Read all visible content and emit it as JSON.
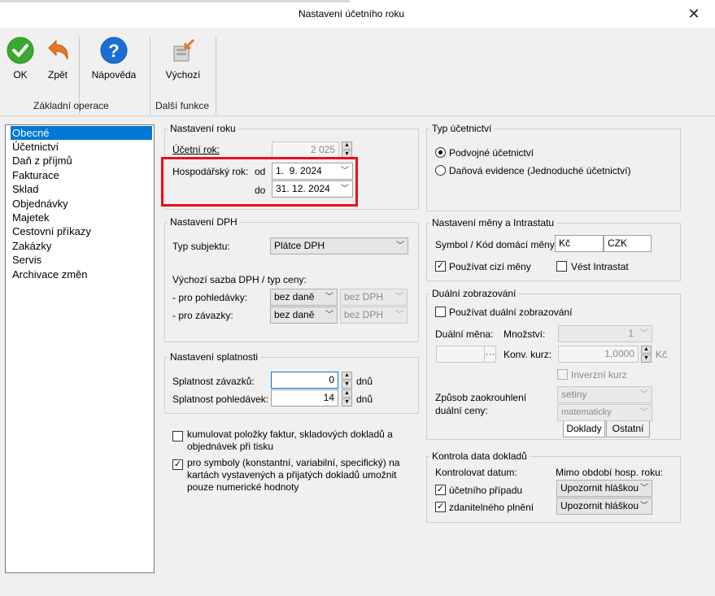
{
  "window": {
    "title": "Nastavení účetního roku",
    "close_glyph": "✕"
  },
  "toolbar": {
    "ok_label": "OK",
    "back_label": "Zpět",
    "help_label": "Nápověda",
    "default_label": "Výchozí",
    "group_basic": "Základní operace",
    "group_more": "Další funkce",
    "icons": {
      "ok": "check-icon",
      "back": "undo-arrow-icon",
      "help": "help-question-icon",
      "default": "reset-defaults-icon"
    }
  },
  "sidebar": {
    "items": [
      {
        "label": "Obecné",
        "selected": true
      },
      {
        "label": "Účetnictví"
      },
      {
        "label": "Daň z příjmů"
      },
      {
        "label": "Fakturace"
      },
      {
        "label": "Sklad"
      },
      {
        "label": "Objednávky"
      },
      {
        "label": "Majetek"
      },
      {
        "label": "Cestovní příkazy"
      },
      {
        "label": "Zakázky"
      },
      {
        "label": "Servis"
      },
      {
        "label": "Archivace změn"
      }
    ]
  },
  "year": {
    "group_label": "Nastavení roku",
    "accounting_year_label": "Účetní rok:",
    "accounting_year_value": "2 025",
    "fiscal_year_label": "Hospodářský rok:",
    "from_label": "od",
    "from_value": "1.  9. 2024",
    "to_label": "do",
    "to_value": "31. 12. 2024"
  },
  "vat": {
    "group_label": "Nastavení DPH",
    "subject_label": "Typ subjektu:",
    "subject_value": "Plátce DPH",
    "default_rate_label": "Výchozí sazba DPH / typ ceny:",
    "receivables_label": "- pro pohledávky:",
    "payables_label": "- pro závazky:",
    "receivables_rate": "bez daně",
    "receivables_type": "bez DPH",
    "payables_rate": "bez daně",
    "payables_type": "bez DPH"
  },
  "due": {
    "group_label": "Nastavení splatnosti",
    "payables_label": "Splatnost závazků:",
    "payables_value": "0",
    "receivables_label": "Splatnost pohledávek:",
    "receivables_value": "14",
    "unit": "dnů"
  },
  "options": {
    "cumulate_label": "kumulovat položky faktur, skladových dokladů a objednávek při tisku",
    "cumulate_checked": false,
    "symbols_label": "pro symboly (konstantní, variabilní, specifický) na kartách vystavených a přijatých dokladů umožnit pouze numerické hodnoty",
    "symbols_checked": true
  },
  "accounting_type": {
    "group_label": "Typ účetnictví",
    "double_entry_label": "Podvojné účetnictví",
    "tax_records_label": "Daňová evidence (Jednoduché účetnictví)",
    "selected": "double_entry"
  },
  "currency": {
    "group_label": "Nastavení měny a Intrastatu",
    "symbol_label": "Symbol / Kód domácí měny:",
    "symbol_value": "Kč",
    "code_value": "CZK",
    "foreign_label": "Používat cizí měny",
    "foreign_checked": true,
    "intrastat_label": "Vést Intrastat",
    "intrastat_checked": false
  },
  "dual": {
    "group_label": "Duální zobrazování",
    "use_label": "Používat duální zobrazování",
    "use_checked": false,
    "currency_label": "Duální měna:",
    "currency_value": "",
    "browse_glyph": "···",
    "quantity_label": "Množství:",
    "quantity_value": "1",
    "rate_label": "Konv. kurz:",
    "rate_value": "1,0000",
    "rate_unit": "Kč",
    "inverse_label": "Inverzní kurz",
    "rounding_label_line1": "Způsob zaokrouhlení",
    "rounding_label_line2": "duální ceny:",
    "rounding_value": "setiny",
    "rounding_method": "matematicky",
    "tabs": [
      "Doklady",
      "Ostatní"
    ]
  },
  "date_check": {
    "group_label": "Kontrola data dokladů",
    "check_label": "Kontrolovat datum:",
    "outside_label": "Mimo období hosp. roku:",
    "accounting_case_label": "účetního případu",
    "accounting_case_checked": true,
    "taxable_label": "zdanitelného plnění",
    "taxable_checked": true,
    "accounting_case_action": "Upozornit hláškou",
    "taxable_action": "Upozornit hláškou"
  },
  "colors": {
    "selection": "#0078d7",
    "highlight_border": "#e8101a",
    "ok_green": "#3aa832",
    "help_blue": "#1a6fd4",
    "back_orange": "#e8762b"
  }
}
